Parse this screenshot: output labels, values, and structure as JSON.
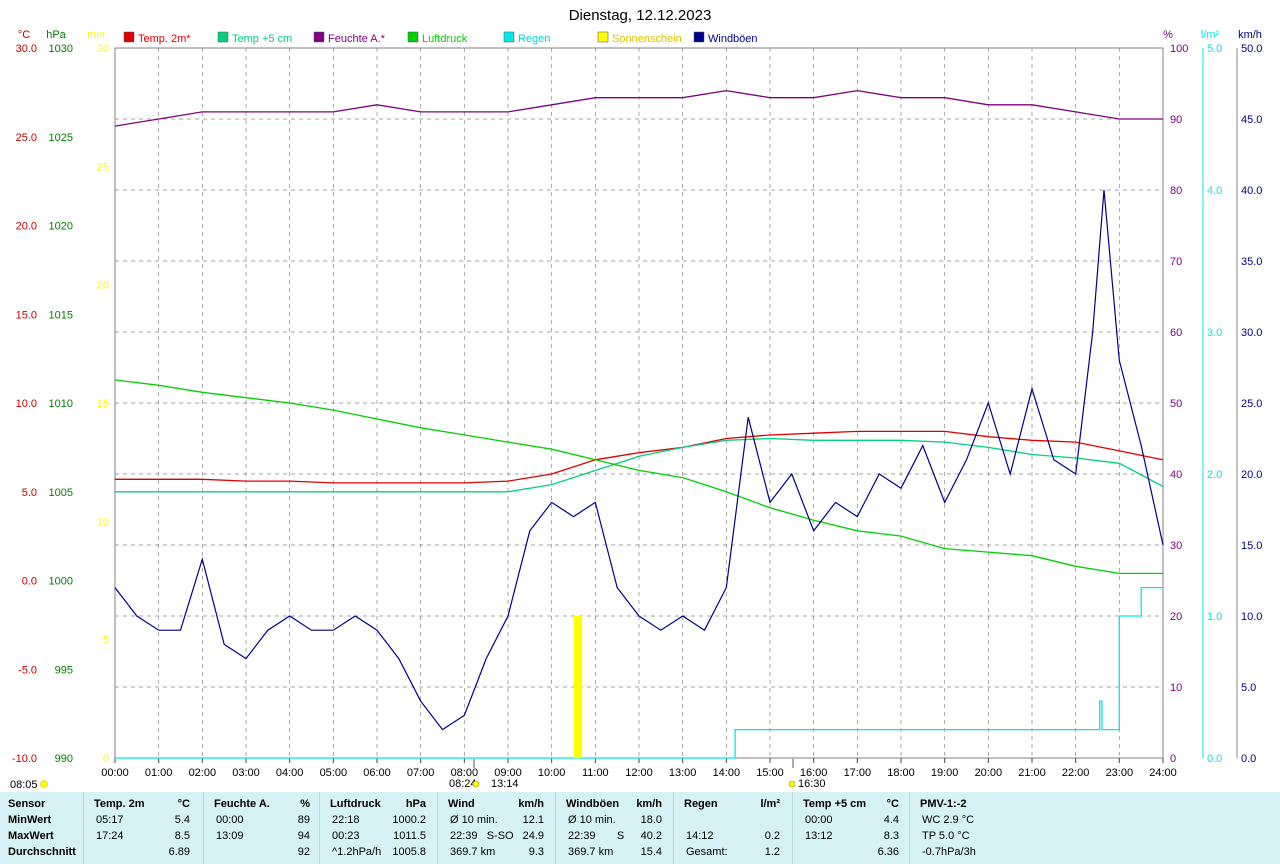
{
  "chart_data": {
    "type": "line",
    "title": "Dienstag, 12.12.2023",
    "x_ticks": [
      "00:00",
      "01:00",
      "02:00",
      "03:00",
      "04:00",
      "05:00",
      "06:00",
      "07:00",
      "08:00",
      "09:00",
      "10:00",
      "11:00",
      "12:00",
      "13:00",
      "14:00",
      "15:00",
      "16:00",
      "17:00",
      "18:00",
      "19:00",
      "20:00",
      "21:00",
      "22:00",
      "23:00",
      "24:00"
    ],
    "grid": true,
    "legend": {
      "placement": "top",
      "entries": [
        {
          "name": "Temp. 2m*",
          "color": "#e00000"
        },
        {
          "name": "Temp +5 cm",
          "color": "#00d080"
        },
        {
          "name": "Feuchte A.*",
          "color": "#800080"
        },
        {
          "name": "Luftdruck",
          "color": "#00d000"
        },
        {
          "name": "Regen",
          "color": "#00e8e8"
        },
        {
          "name": "Sonnenschein",
          "color": "#ffff00"
        },
        {
          "name": "Windböen",
          "color": "#00008b"
        }
      ]
    },
    "axes": {
      "temp": {
        "unit": "°C",
        "color": "#c00000",
        "ylim": [
          -10,
          30
        ],
        "ticks": [
          "30.0",
          "25.0",
          "20.0",
          "15.0",
          "10.0",
          "5.0",
          "0.0",
          "-5.0",
          "-10.0"
        ]
      },
      "pressure": {
        "unit": "hPa",
        "color": "#008000",
        "ylim": [
          990,
          1030
        ],
        "ticks": [
          "1030",
          "1025",
          "1020",
          "1015",
          "1010",
          "1005",
          "1000",
          "995",
          "990"
        ]
      },
      "sun_min": {
        "unit": "min",
        "color": "#ffff00",
        "ylim": [
          0,
          30
        ],
        "ticks": [
          "30",
          "25",
          "20",
          "15",
          "10",
          "5",
          "0"
        ]
      },
      "humidity": {
        "unit": "%",
        "color": "#800080",
        "ylim": [
          0,
          100
        ],
        "ticks": [
          "100",
          "90",
          "80",
          "70",
          "60",
          "50",
          "40",
          "30",
          "20",
          "10",
          "0"
        ]
      },
      "rain": {
        "unit": "l/m²",
        "color": "#00e8e8",
        "ylim": [
          0,
          5
        ],
        "ticks": [
          "5.0",
          "4.0",
          "3.0",
          "2.0",
          "1.0",
          "0.0"
        ]
      },
      "wind": {
        "unit": "km/h",
        "color": "#000080",
        "ylim": [
          0,
          50
        ],
        "ticks": [
          "50.0",
          "45.0",
          "40.0",
          "35.0",
          "30.0",
          "25.0",
          "20.0",
          "15.0",
          "10.0",
          "5.0",
          "0.0"
        ]
      }
    },
    "series": [
      {
        "name": "Temp. 2m*",
        "axis": "temp",
        "color": "#e00000",
        "x": [
          0,
          1,
          2,
          3,
          4,
          5,
          6,
          7,
          8,
          9,
          10,
          11,
          12,
          13,
          14,
          15,
          16,
          17,
          18,
          19,
          20,
          21,
          22,
          23,
          24
        ],
        "y": [
          5.7,
          5.7,
          5.7,
          5.6,
          5.6,
          5.5,
          5.5,
          5.5,
          5.5,
          5.6,
          6.0,
          6.8,
          7.2,
          7.5,
          8.0,
          8.2,
          8.3,
          8.4,
          8.4,
          8.4,
          8.1,
          7.9,
          7.8,
          7.3,
          6.8
        ]
      },
      {
        "name": "Temp +5 cm",
        "axis": "temp",
        "color": "#00d080",
        "x": [
          0,
          1,
          2,
          3,
          4,
          5,
          6,
          7,
          8,
          9,
          10,
          11,
          12,
          13,
          14,
          15,
          16,
          17,
          18,
          19,
          20,
          21,
          22,
          23,
          24
        ],
        "y": [
          5.0,
          5.0,
          5.0,
          5.0,
          5.0,
          5.0,
          5.0,
          5.0,
          5.0,
          5.0,
          5.4,
          6.2,
          7.0,
          7.5,
          7.9,
          8.0,
          7.9,
          7.9,
          7.9,
          7.8,
          7.5,
          7.1,
          6.9,
          6.6,
          5.3
        ]
      },
      {
        "name": "Feuchte A.*",
        "axis": "humidity",
        "color": "#800080",
        "x": [
          0,
          1,
          2,
          3,
          4,
          5,
          6,
          7,
          8,
          9,
          10,
          11,
          12,
          13,
          14,
          15,
          16,
          17,
          18,
          19,
          20,
          21,
          22,
          23,
          24
        ],
        "y": [
          89,
          90,
          91,
          91,
          91,
          91,
          92,
          91,
          91,
          91,
          92,
          93,
          93,
          93,
          94,
          93,
          93,
          94,
          93,
          93,
          92,
          92,
          91,
          90,
          90
        ]
      },
      {
        "name": "Luftdruck",
        "axis": "pressure",
        "color": "#00d000",
        "x": [
          0,
          1,
          2,
          3,
          4,
          5,
          6,
          7,
          8,
          9,
          10,
          11,
          12,
          13,
          14,
          15,
          16,
          17,
          18,
          19,
          20,
          21,
          22,
          23,
          24
        ],
        "y": [
          1011.3,
          1011.0,
          1010.6,
          1010.3,
          1010.0,
          1009.6,
          1009.1,
          1008.6,
          1008.2,
          1007.8,
          1007.4,
          1006.8,
          1006.2,
          1005.8,
          1005.0,
          1004.1,
          1003.4,
          1002.8,
          1002.5,
          1001.8,
          1001.6,
          1001.4,
          1000.8,
          1000.4,
          1000.4
        ]
      },
      {
        "name": "Regen",
        "axis": "rain",
        "color": "#00e8e8",
        "x": [
          0,
          14.1,
          14.2,
          22.5,
          22.55,
          22.6,
          22.65,
          22.7,
          23.0,
          23.1,
          23.5,
          24
        ],
        "y": [
          0,
          0,
          0.2,
          0.2,
          0.4,
          0.2,
          0.2,
          0.2,
          1.0,
          1.0,
          1.2,
          1.2
        ]
      },
      {
        "name": "Windböen",
        "axis": "wind",
        "color": "#00008b",
        "x": [
          0,
          0.5,
          1,
          1.5,
          2,
          2.5,
          3,
          3.5,
          4,
          4.5,
          5,
          5.5,
          6,
          6.5,
          7,
          7.5,
          8,
          8.25,
          8.5,
          9,
          9.5,
          10,
          10.5,
          11,
          11.5,
          12,
          12.5,
          13,
          13.5,
          14,
          14.5,
          15,
          15.5,
          16,
          16.5,
          17,
          17.5,
          18,
          18.5,
          19,
          19.5,
          20,
          20.5,
          21,
          21.5,
          22,
          22.39,
          22.65,
          23,
          23.5,
          24
        ],
        "y": [
          12,
          10,
          9,
          9,
          14,
          8,
          7,
          9,
          10,
          9,
          9,
          10,
          9,
          7,
          4,
          2,
          3,
          5,
          7,
          10,
          16,
          18,
          17,
          18,
          12,
          10,
          9,
          10,
          9,
          12,
          24,
          18,
          20,
          16,
          18,
          17,
          20,
          19,
          22,
          18,
          21,
          25,
          20,
          26,
          21,
          20,
          30,
          40,
          28,
          22,
          15
        ]
      },
      {
        "name": "Sonnenschein",
        "axis": "sun_min",
        "color": "#ffff00",
        "x": [
          10.55,
          10.6,
          10.65
        ],
        "y": [
          6,
          6,
          6
        ]
      }
    ],
    "markers": {
      "sunrise": "08:05",
      "moon_events": [
        "08:24",
        "13:14",
        "16:30"
      ]
    }
  },
  "summary": {
    "row_labels": [
      "Sensor",
      "MinWert",
      "MaxWert",
      "Durchschnitt"
    ],
    "columns": [
      {
        "header": "Temp. 2m",
        "unit": "°C",
        "rows": [
          [
            "05:17",
            "5.4"
          ],
          [
            "17:24",
            "8.5"
          ],
          [
            "",
            "6.89"
          ]
        ]
      },
      {
        "header": "Feuchte A.",
        "unit": "%",
        "rows": [
          [
            "00:00",
            "89"
          ],
          [
            "13:09",
            "94"
          ],
          [
            "",
            "92"
          ]
        ]
      },
      {
        "header": "Luftdruck",
        "unit": "hPa",
        "rows": [
          [
            "22:18",
            "1000.2"
          ],
          [
            "00:23",
            "1011.5"
          ],
          [
            "^1.2hPa/h",
            "1005.8"
          ]
        ]
      },
      {
        "header": "Wind",
        "unit": "km/h",
        "rows": [
          [
            "Ø 10 min.",
            "12.1"
          ],
          [
            "22:39   S-SO",
            "24.9"
          ],
          [
            "369.7 km",
            "9.3"
          ]
        ]
      },
      {
        "header": "Windböen",
        "unit": "km/h",
        "rows": [
          [
            "Ø 10 min.",
            "18.0"
          ],
          [
            "22:39       S",
            "40.2"
          ],
          [
            "369.7 km",
            "15.4"
          ]
        ]
      },
      {
        "header": "Regen",
        "unit": "l/m²",
        "rows": [
          [
            "",
            ""
          ],
          [
            "14:12",
            "0.2"
          ],
          [
            "Gesamt:",
            "1.2"
          ]
        ]
      },
      {
        "header": "Temp +5 cm",
        "unit": "°C",
        "rows": [
          [
            "00:00",
            "4.4"
          ],
          [
            "13:12",
            "8.3"
          ],
          [
            "",
            "6.36"
          ]
        ]
      },
      {
        "header": "PMV-1:-2",
        "unit": "",
        "rows": [
          [
            "WC 2.9 °C",
            ""
          ],
          [
            "TP 5.0 °C",
            ""
          ],
          [
            "-0.7hPa/3h",
            ""
          ]
        ]
      }
    ]
  }
}
